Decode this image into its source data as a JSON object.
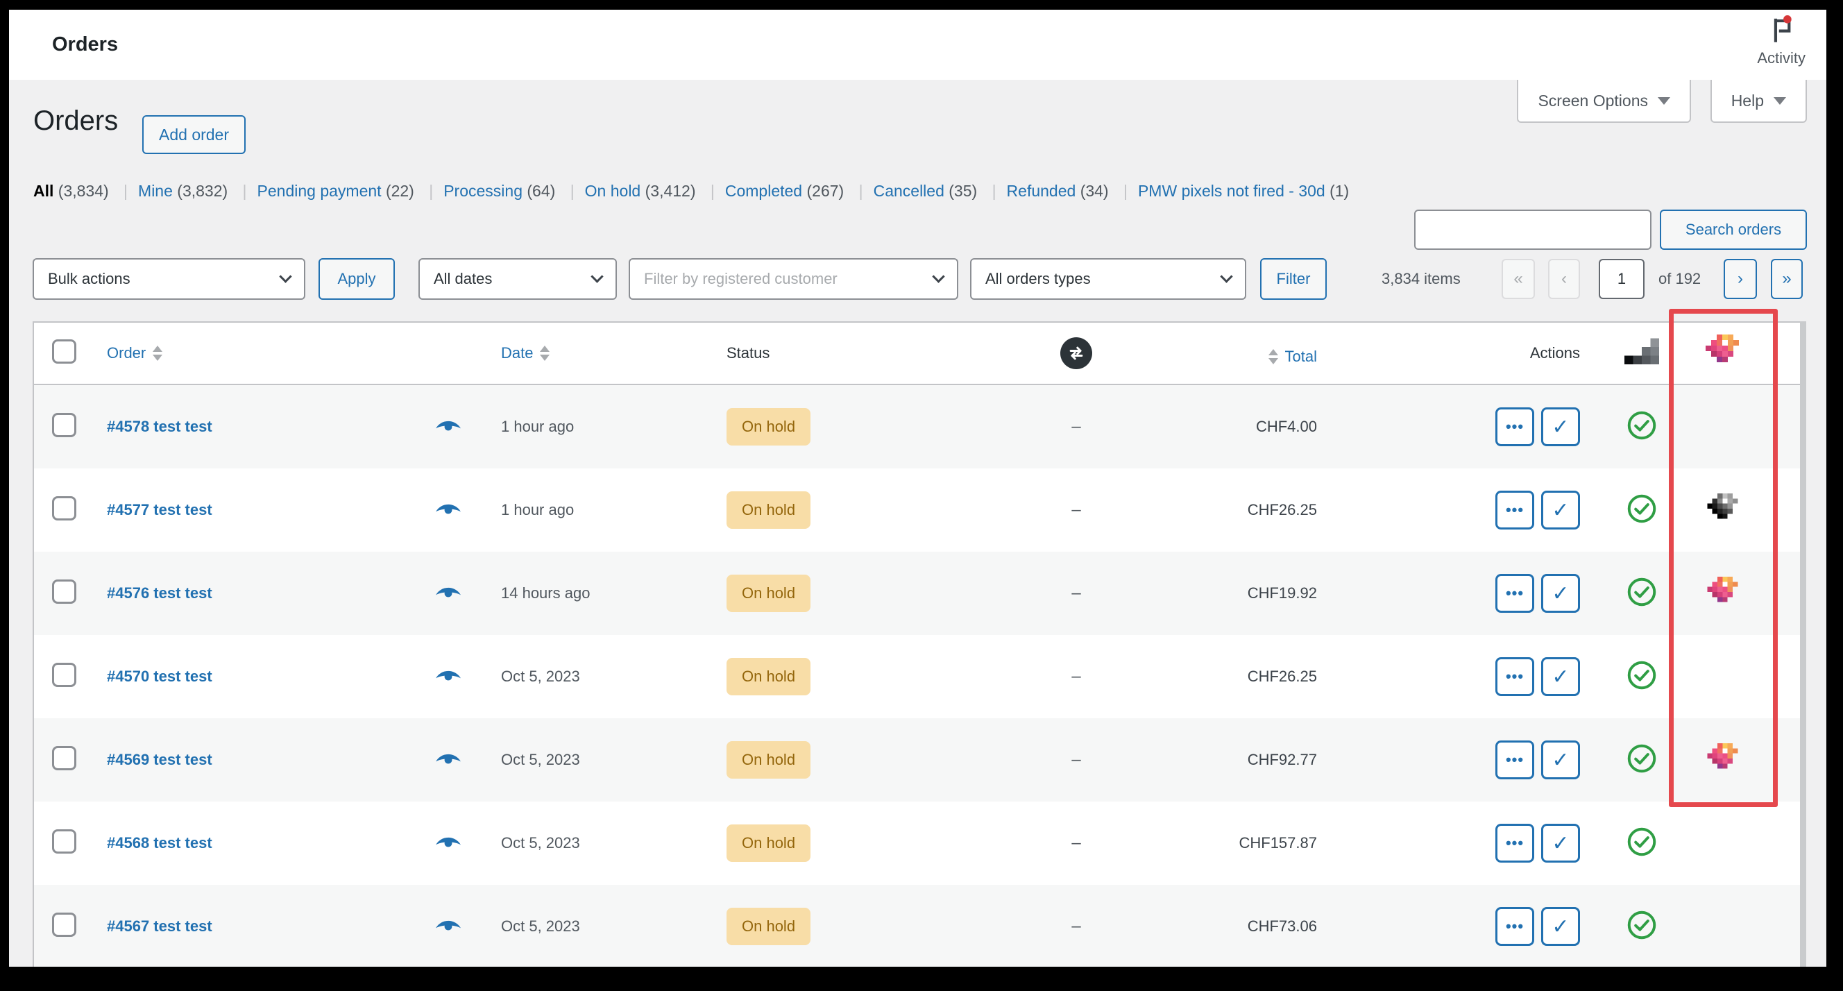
{
  "admin_bar": {
    "title": "Orders",
    "activity_label": "Activity"
  },
  "tabs": {
    "screen_options": "Screen Options",
    "help": "Help"
  },
  "page": {
    "title": "Orders",
    "add_order_label": "Add order"
  },
  "filters": {
    "views": [
      {
        "label": "All",
        "count": "(3,834)",
        "current": true
      },
      {
        "label": "Mine",
        "count": "(3,832)",
        "current": false
      },
      {
        "label": "Pending payment",
        "count": "(22)",
        "current": false
      },
      {
        "label": "Processing",
        "count": "(64)",
        "current": false
      },
      {
        "label": "On hold",
        "count": "(3,412)",
        "current": false
      },
      {
        "label": "Completed",
        "count": "(267)",
        "current": false
      },
      {
        "label": "Cancelled",
        "count": "(35)",
        "current": false
      },
      {
        "label": "Refunded",
        "count": "(34)",
        "current": false
      },
      {
        "label": "PMW pixels not fired - 30d",
        "count": "(1)",
        "current": false
      }
    ]
  },
  "search": {
    "input_value": "",
    "button_label": "Search orders"
  },
  "toolbar": {
    "bulk_actions_value": "Bulk actions",
    "apply_label": "Apply",
    "dates_value": "All dates",
    "customer_placeholder": "Filter by registered customer",
    "order_types_value": "All orders types",
    "filter_label": "Filter"
  },
  "pagination": {
    "items_text": "3,834 items",
    "first_label": "«",
    "prev_label": "‹",
    "current_page": "1",
    "of_text": "of 192",
    "next_label": "›",
    "last_label": "»"
  },
  "table": {
    "headers": {
      "order": "Order",
      "date": "Date",
      "status": "Status",
      "total": "Total",
      "actions": "Actions"
    },
    "action_dots_label": "•••",
    "action_check_label": "✓",
    "rows": [
      {
        "order": "#4578 test test",
        "date": "1 hour ago",
        "status": "On hold",
        "note": "–",
        "total": "CHF4.00",
        "gem": "none"
      },
      {
        "order": "#4577 test test",
        "date": "1 hour ago",
        "status": "On hold",
        "note": "–",
        "total": "CHF26.25",
        "gem": "gray"
      },
      {
        "order": "#4576 test test",
        "date": "14 hours ago",
        "status": "On hold",
        "note": "–",
        "total": "CHF19.92",
        "gem": "color"
      },
      {
        "order": "#4570 test test",
        "date": "Oct 5, 2023",
        "status": "On hold",
        "note": "–",
        "total": "CHF26.25",
        "gem": "none"
      },
      {
        "order": "#4569 test test",
        "date": "Oct 5, 2023",
        "status": "On hold",
        "note": "–",
        "total": "CHF92.77",
        "gem": "color"
      },
      {
        "order": "#4568 test test",
        "date": "Oct 5, 2023",
        "status": "On hold",
        "note": "–",
        "total": "CHF157.87",
        "gem": "none"
      },
      {
        "order": "#4567 test test",
        "date": "Oct 5, 2023",
        "status": "On hold",
        "note": "–",
        "total": "CHF73.06",
        "gem": "none"
      }
    ]
  },
  "colors": {
    "accent": "#2271b1",
    "on_hold_bg": "#f8dda7",
    "on_hold_text": "#94660c",
    "highlight_red": "#e5484d",
    "success_green": "#2f9e44"
  }
}
